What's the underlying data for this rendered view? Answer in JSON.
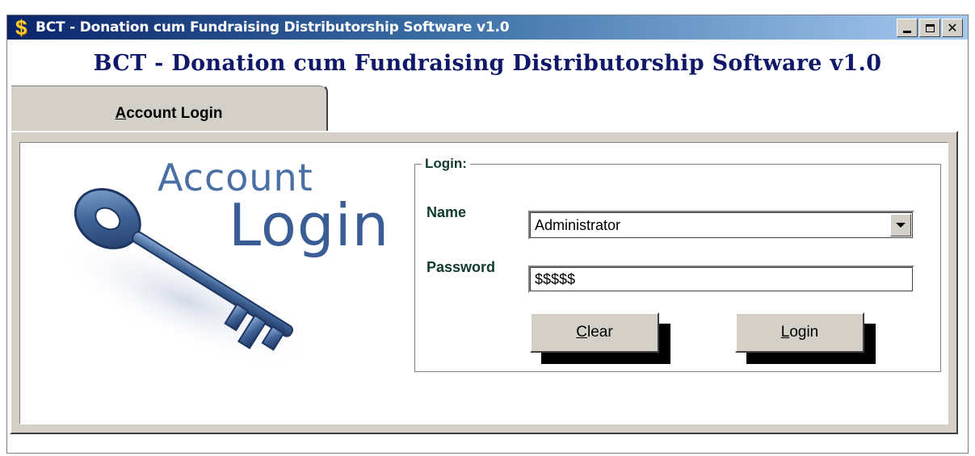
{
  "window": {
    "title": "BCT - Donation cum Fundraising Distributorship Software v1.0",
    "icon": "dollar-icon",
    "controls": {
      "minimize": "minimize-icon",
      "maximize": "maximize-icon",
      "close_glyph": "✕"
    }
  },
  "app_heading": "BCT - Donation cum Fundraising Distributorship Software v1.0",
  "tabs": [
    {
      "label_mnemonic": "A",
      "label_rest": "ccount Login"
    }
  ],
  "art": {
    "word1": "Account",
    "word2": "Login",
    "icon": "key-icon"
  },
  "login": {
    "group_label": "Login:",
    "name_label": "Name",
    "name_value": "Administrator",
    "password_label": "Password",
    "password_value": "$$$$$",
    "clear_mnemonic": "C",
    "clear_rest": "lear",
    "login_mnemonic": "L",
    "login_rest": "ogin"
  },
  "colors": {
    "titlebar_start": "#0a246a",
    "titlebar_end": "#a6caf0",
    "heading": "#10186a",
    "face": "#d4d0c8",
    "art_text": "#4a6fa5"
  }
}
